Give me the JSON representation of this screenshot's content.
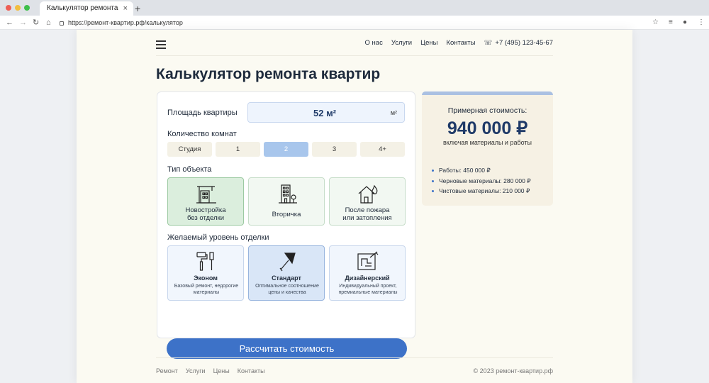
{
  "browser": {
    "tab_title": "Калькулятор ремонта квартир",
    "tab_close": "×",
    "new_tab": "+",
    "url": "https://ремонт-квартир.рф/калькулятор",
    "dots": [
      "#ee5e55",
      "#f2bd3f",
      "#3fbf4b"
    ]
  },
  "nav": {
    "about": "О нас",
    "services": "Услуги",
    "prices": "Цены",
    "contacts": "Контакты",
    "phone": "+7 (495) 123-45-67"
  },
  "page_title": "Калькулятор ремонта квартир",
  "calculator": {
    "area_label": "Площадь квартиры",
    "area_value": "52 м²",
    "area_unit": "м²",
    "rooms_label": "Количество комнат",
    "rooms": [
      "Студия",
      "1",
      "2",
      "3",
      "4+"
    ],
    "rooms_selected": "2",
    "type_label": "Тип объекта",
    "types": [
      {
        "l1": "Новостройка",
        "l2": "без отделки",
        "icon": "building-crane-icon"
      },
      {
        "l1": "Вторичка",
        "l2": "",
        "icon": "apartment-building-icon"
      },
      {
        "l1": "После пожара",
        "l2": "или затопления",
        "icon": "house-fire-icon"
      }
    ],
    "finish_label": "Желаемый уровень отделки",
    "finishes": [
      {
        "t": "Эконом",
        "s": "Базовый ремонт, недорогие материалы",
        "icon": "paint-roller-icon"
      },
      {
        "t": "Стандарт",
        "s": "Оптимальное соотношение цены и качества",
        "icon": "trowel-icon"
      },
      {
        "t": "Дизайнерский",
        "s": "Индивидуальный проект, премиальные материалы",
        "icon": "design-blueprint-icon"
      }
    ],
    "button": "Рассчитать стоимость"
  },
  "result": {
    "caption": "Примерная стоимость:",
    "price": "940 000 ₽",
    "note": "включая материалы и работы",
    "items": [
      "Работы: 450 000 ₽",
      "Черновые материалы: 280 000 ₽",
      "Чистовые материалы: 210 000 ₽"
    ]
  },
  "footer": {
    "links": [
      "Ремонт",
      "Услуги",
      "Цены",
      "Контакты"
    ],
    "copyright": "© 2023 ремонт-квартир.рф"
  },
  "colors": {
    "accent": "#3d72c8",
    "price": "#1f3a68",
    "selected_room": "#a8c6ec"
  }
}
